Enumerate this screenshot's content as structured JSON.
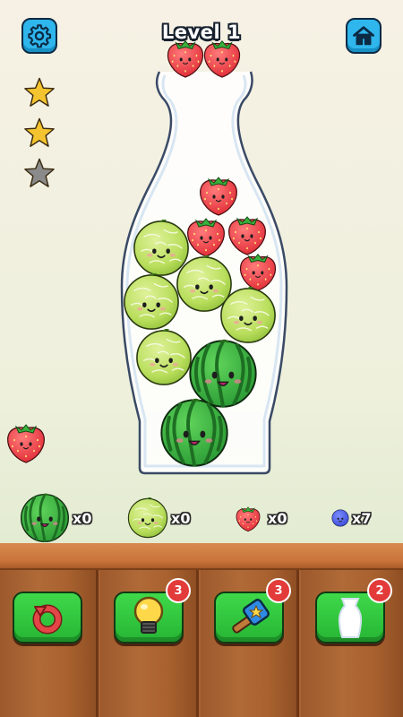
{
  "header": {
    "level_title": "Level 1",
    "settings_icon": "gear-icon",
    "home_icon": "home-icon"
  },
  "stars": {
    "earned": 2,
    "total": 3,
    "colors": {
      "earned": "#f4c430",
      "empty": "#8a8a8a"
    }
  },
  "bottle": {
    "fruits": [
      {
        "type": "strawberry"
      },
      {
        "type": "strawberry"
      },
      {
        "type": "strawberry"
      },
      {
        "type": "strawberry"
      },
      {
        "type": "melon"
      },
      {
        "type": "melon"
      },
      {
        "type": "melon"
      },
      {
        "type": "melon"
      },
      {
        "type": "melon"
      },
      {
        "type": "watermelon"
      },
      {
        "type": "watermelon"
      }
    ],
    "next_fruit": "strawberry",
    "side_fruit": "strawberry"
  },
  "counters": [
    {
      "fruit": "watermelon",
      "label": "x0"
    },
    {
      "fruit": "melon",
      "label": "x0"
    },
    {
      "fruit": "strawberry",
      "label": "x0"
    },
    {
      "fruit": "blueberry",
      "label": "x7"
    }
  ],
  "powerups": [
    {
      "name": "undo",
      "icon": "undo-icon",
      "badge": ""
    },
    {
      "name": "hint",
      "icon": "lightbulb-icon",
      "badge": "3"
    },
    {
      "name": "hammer",
      "icon": "hammer-icon",
      "badge": "3"
    },
    {
      "name": "bottle",
      "icon": "bottle-icon",
      "badge": "2"
    }
  ],
  "colors": {
    "button_blue": "#2fb6ec",
    "button_green": "#2ec83c",
    "badge_red": "#e33a3a",
    "wood": "#a86334"
  }
}
